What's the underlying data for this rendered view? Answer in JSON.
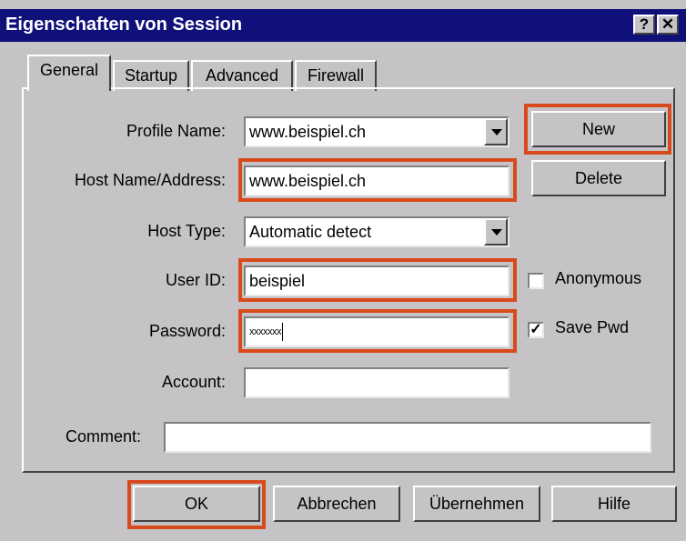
{
  "window": {
    "title": "Eigenschaften von Session",
    "help_button": "?",
    "close_button": "✕"
  },
  "tabs": [
    {
      "label": "General",
      "active": true
    },
    {
      "label": "Startup",
      "active": false
    },
    {
      "label": "Advanced",
      "active": false
    },
    {
      "label": "Firewall",
      "active": false
    }
  ],
  "form": {
    "profile_name": {
      "label": "Profile Name:",
      "value": "www.beispiel.ch"
    },
    "host_name": {
      "label": "Host Name/Address:",
      "value": "www.beispiel.ch"
    },
    "host_type": {
      "label": "Host Type:",
      "value": "Automatic detect"
    },
    "user_id": {
      "label": "User ID:",
      "value": "beispiel"
    },
    "password": {
      "label": "Password:",
      "value": "xxxxxxx"
    },
    "account": {
      "label": "Account:",
      "value": ""
    },
    "comment": {
      "label": "Comment:",
      "value": ""
    }
  },
  "side_buttons": {
    "new": "New",
    "delete": "Delete"
  },
  "checkboxes": {
    "anonymous": {
      "label": "Anonymous",
      "checked": false
    },
    "save_pwd": {
      "label": "Save Pwd",
      "checked": true
    }
  },
  "footer_buttons": {
    "ok": "OK",
    "cancel": "Abbrechen",
    "apply": "Übernehmen",
    "help": "Hilfe"
  },
  "colors": {
    "titlebar": "#10107a",
    "highlight": "#d84a1b",
    "face": "#c6c3c6"
  }
}
